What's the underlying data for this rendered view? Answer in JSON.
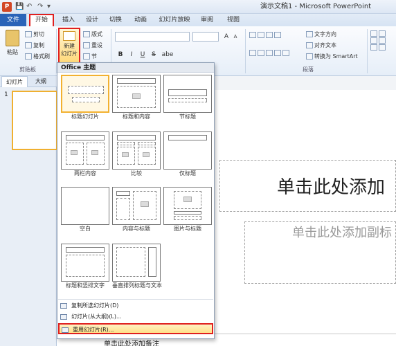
{
  "app": {
    "icon_letter": "P",
    "window_title": "演示文稿1 - Microsoft PowerPoint"
  },
  "quick_access": {
    "save": "💾",
    "undo": "↶",
    "redo": "↷",
    "customize": "▾"
  },
  "tabs": [
    {
      "label": "文件"
    },
    {
      "label": "开始"
    },
    {
      "label": "插入"
    },
    {
      "label": "设计"
    },
    {
      "label": "切换"
    },
    {
      "label": "动画"
    },
    {
      "label": "幻灯片放映"
    },
    {
      "label": "审阅"
    },
    {
      "label": "视图"
    }
  ],
  "ribbon": {
    "clipboard": {
      "paste": "粘贴",
      "cut": "剪切",
      "copy": "复制",
      "format_painter": "格式刷",
      "group_label": "剪贴板"
    },
    "slides": {
      "new_slide_line1": "新建",
      "new_slide_line2": "幻灯片",
      "layout": "版式",
      "reset": "重设",
      "section": "节"
    },
    "font": {
      "bold": "B",
      "italic": "I",
      "underline": "U",
      "strike": "S",
      "shadow": "abe",
      "size_up": "A",
      "size_down": "A"
    },
    "paragraph": {
      "text_direction": "文字方向",
      "align_text": "对齐文本",
      "convert_smartart": "转换为 SmartArt",
      "group_label": "段落"
    }
  },
  "left_pane": {
    "tab_slides": "幻灯片",
    "tab_outline": "大纲",
    "slide_number": "1"
  },
  "gallery": {
    "title": "Office 主题",
    "layouts": [
      {
        "label": "标题幻灯片"
      },
      {
        "label": "标题和内容"
      },
      {
        "label": "节标题"
      },
      {
        "label": "两栏内容"
      },
      {
        "label": "比较"
      },
      {
        "label": "仅标题"
      },
      {
        "label": "空白"
      },
      {
        "label": "内容与标题"
      },
      {
        "label": "图片与标题"
      },
      {
        "label": "标题和竖排文字"
      },
      {
        "label": "垂直排列标题与文本"
      }
    ],
    "menu": {
      "duplicate": "复制所选幻灯片(D)",
      "from_outline": "幻灯片(从大纲)(L)...",
      "reuse": "重用幻灯片(R)..."
    }
  },
  "slide": {
    "title_placeholder": "单击此处添加",
    "subtitle_placeholder": "单击此处添加副标"
  },
  "notes": {
    "placeholder": "单击此处添加备注"
  }
}
